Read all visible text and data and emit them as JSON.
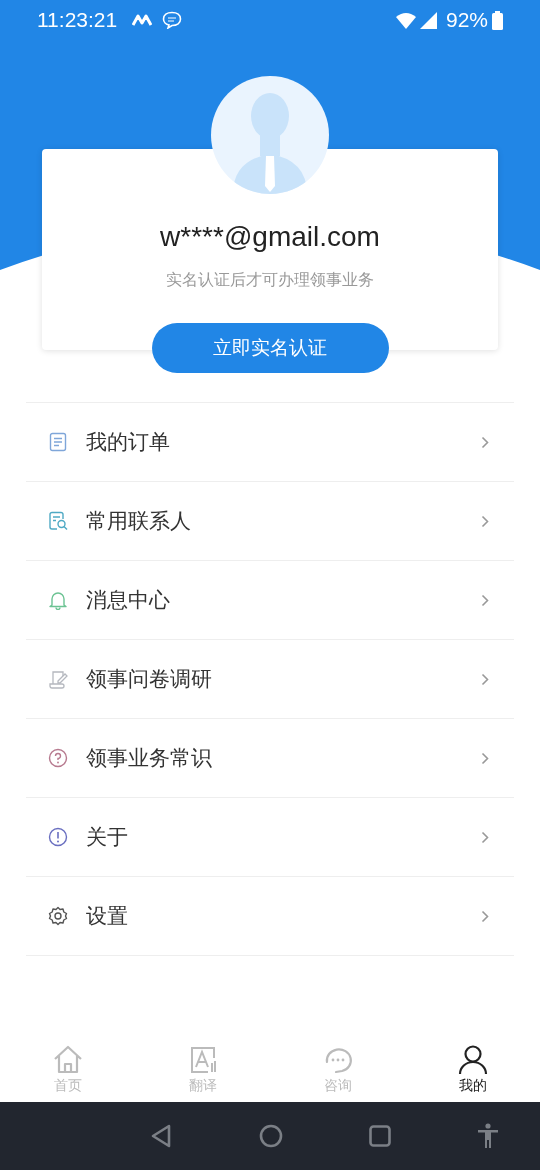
{
  "status_bar": {
    "time": "11:23:21",
    "battery": "92%"
  },
  "profile": {
    "email": "w****@gmail.com",
    "hint": "实名认证后才可办理领事业务",
    "verify_button": "立即实名认证"
  },
  "menu": [
    {
      "label": "我的订单",
      "kind": "document"
    },
    {
      "label": "常用联系人",
      "kind": "contacts"
    },
    {
      "label": "消息中心",
      "kind": "bell"
    },
    {
      "label": "领事问卷调研",
      "kind": "survey"
    },
    {
      "label": "领事业务常识",
      "kind": "question"
    },
    {
      "label": "关于",
      "kind": "info"
    },
    {
      "label": "设置",
      "kind": "gear"
    }
  ],
  "tabs": [
    {
      "label": "首页",
      "kind": "home",
      "selected": false
    },
    {
      "label": "翻译",
      "kind": "translate",
      "selected": false
    },
    {
      "label": "咨询",
      "kind": "chat",
      "selected": false
    },
    {
      "label": "我的",
      "kind": "person",
      "selected": true
    }
  ]
}
